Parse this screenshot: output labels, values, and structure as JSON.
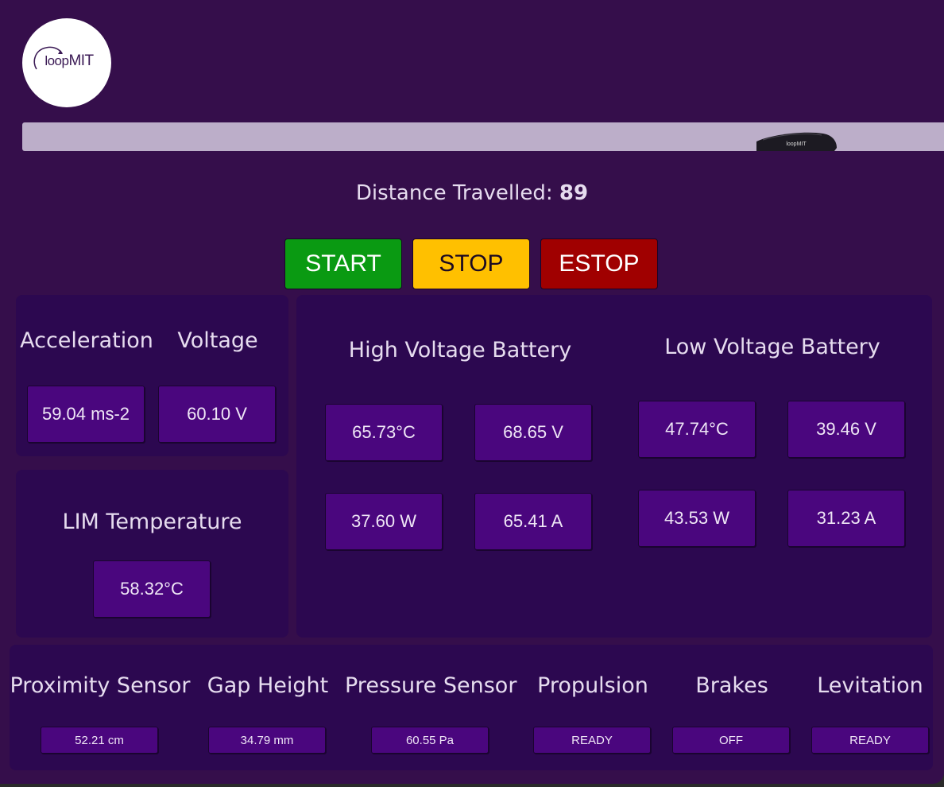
{
  "logo": {
    "text_loop": "loop",
    "text_mit": "MIT"
  },
  "pod": {
    "label": "loopMIT"
  },
  "distance": {
    "label": "Distance Travelled:",
    "value": "89"
  },
  "controls": {
    "start": "START",
    "stop": "STOP",
    "estop": "ESTOP"
  },
  "accel_panel": {
    "acceleration_label": "Acceleration",
    "acceleration_value": "59.04 ms-2",
    "voltage_label": "Voltage",
    "voltage_value": "60.10 V"
  },
  "lim_panel": {
    "label": "LIM Temperature",
    "value": "58.32°C"
  },
  "batteries": {
    "high": {
      "title": "High Voltage Battery",
      "temperature": "65.73°C",
      "voltage": "68.65 V",
      "power": "37.60 W",
      "current": "65.41 A"
    },
    "low": {
      "title": "Low Voltage Battery",
      "temperature": "47.74°C",
      "voltage": "39.46 V",
      "power": "43.53 W",
      "current": "31.23 A"
    }
  },
  "sensors": [
    {
      "label": "Proximity Sensor",
      "value": "52.21 cm"
    },
    {
      "label": "Gap Height",
      "value": "34.79 mm"
    },
    {
      "label": "Pressure Sensor",
      "value": "60.55 Pa"
    },
    {
      "label": "Propulsion",
      "value": "READY"
    },
    {
      "label": "Brakes",
      "value": "OFF"
    },
    {
      "label": "Levitation",
      "value": "READY"
    }
  ],
  "colors": {
    "background": "#350e4b",
    "panel": "#2c0850",
    "value_box": "#4a067e",
    "start": "#0a9a12",
    "stop": "#ffc000",
    "estop": "#a00000",
    "track": "#bcaec9"
  }
}
